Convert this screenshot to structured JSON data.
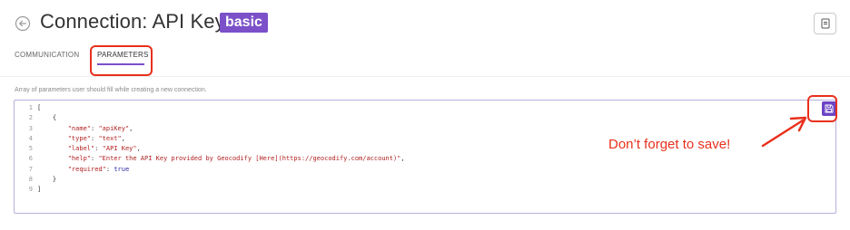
{
  "header": {
    "title": "Connection: API Key",
    "badge": "basic",
    "badge_color": "#7b50c9"
  },
  "icons": {
    "back": "back-arrow-circle-icon",
    "doc": "document-icon",
    "save": "save-floppy-icon"
  },
  "tabs": [
    {
      "label": "COMMUNICATION",
      "active": false
    },
    {
      "label": "PARAMETERS",
      "active": true
    }
  ],
  "helptext": "Array of parameters user should fill while creating a new connection.",
  "editor": {
    "line_numbers": [
      "1",
      "2",
      "3",
      "4",
      "5",
      "6",
      "7",
      "8",
      "9"
    ],
    "lines": [
      "[",
      "    {",
      "        \"name\": \"apiKey\",",
      "        \"type\": \"text\",",
      "        \"label\": \"API Key\",",
      "        \"help\": \"Enter the API Key provided by Geocodify [Here](https://geocodify.com/account)\",",
      "        \"required\": true",
      "    }",
      "]"
    ]
  },
  "annotation": {
    "text": "Don’t forget to save!",
    "color": "#e8301c"
  }
}
